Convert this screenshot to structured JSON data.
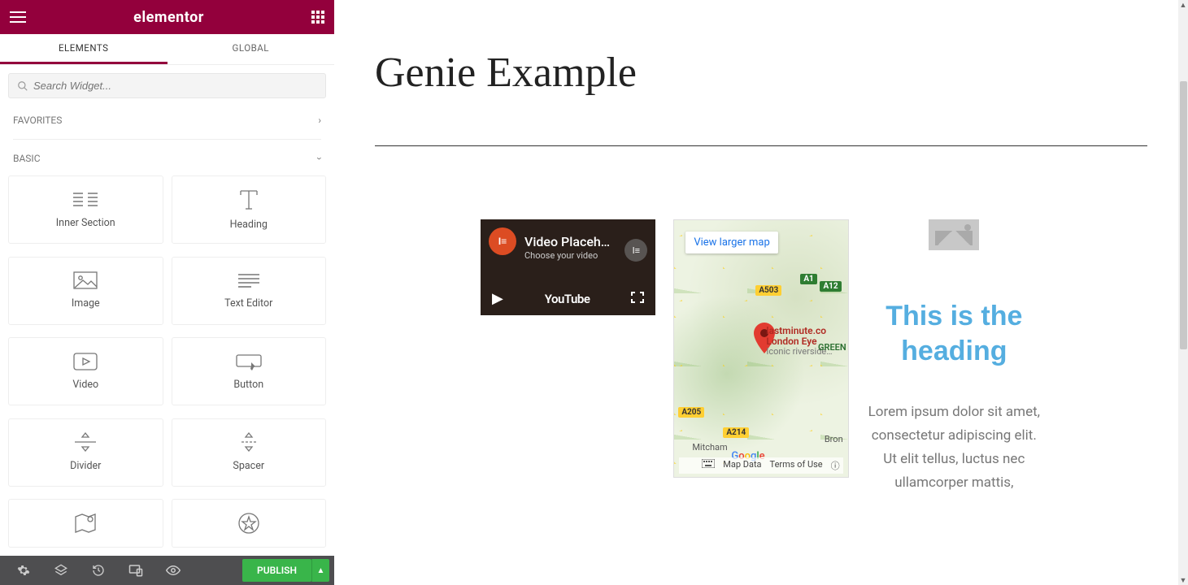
{
  "brand": "elementor",
  "tabs": {
    "elements": "ELEMENTS",
    "global": "GLOBAL"
  },
  "search": {
    "placeholder": "Search Widget..."
  },
  "sections": {
    "favorites": "FAVORITES",
    "basic": "BASIC"
  },
  "widgets": {
    "inner_section": "Inner Section",
    "heading": "Heading",
    "image": "Image",
    "text_editor": "Text Editor",
    "video": "Video",
    "button": "Button",
    "divider": "Divider",
    "spacer": "Spacer"
  },
  "footer": {
    "publish": "PUBLISH"
  },
  "canvas": {
    "title": "Genie Example",
    "video": {
      "title": "Video Placeh…",
      "subtitle": "Choose your video",
      "brand": "YouTube"
    },
    "map": {
      "view_larger": "View larger map",
      "label_line1": "lastminute.co",
      "label_line2": "London Eye",
      "label_line3": "Iconic riverside…",
      "green_tag": "GREEN",
      "roads": {
        "a503": "A503",
        "a1": "A1",
        "a12": "A12",
        "a205": "A205",
        "a214": "A214"
      },
      "google": "Google",
      "mitcham": "Mitcham",
      "bron": "Bron",
      "map_data": "Map Data",
      "terms": "Terms of Use"
    },
    "column3": {
      "heading": "This is the heading",
      "text": "Lorem ipsum dolor sit amet, consectetur adipiscing elit. Ut elit tellus, luctus nec ullamcorper mattis,"
    }
  }
}
